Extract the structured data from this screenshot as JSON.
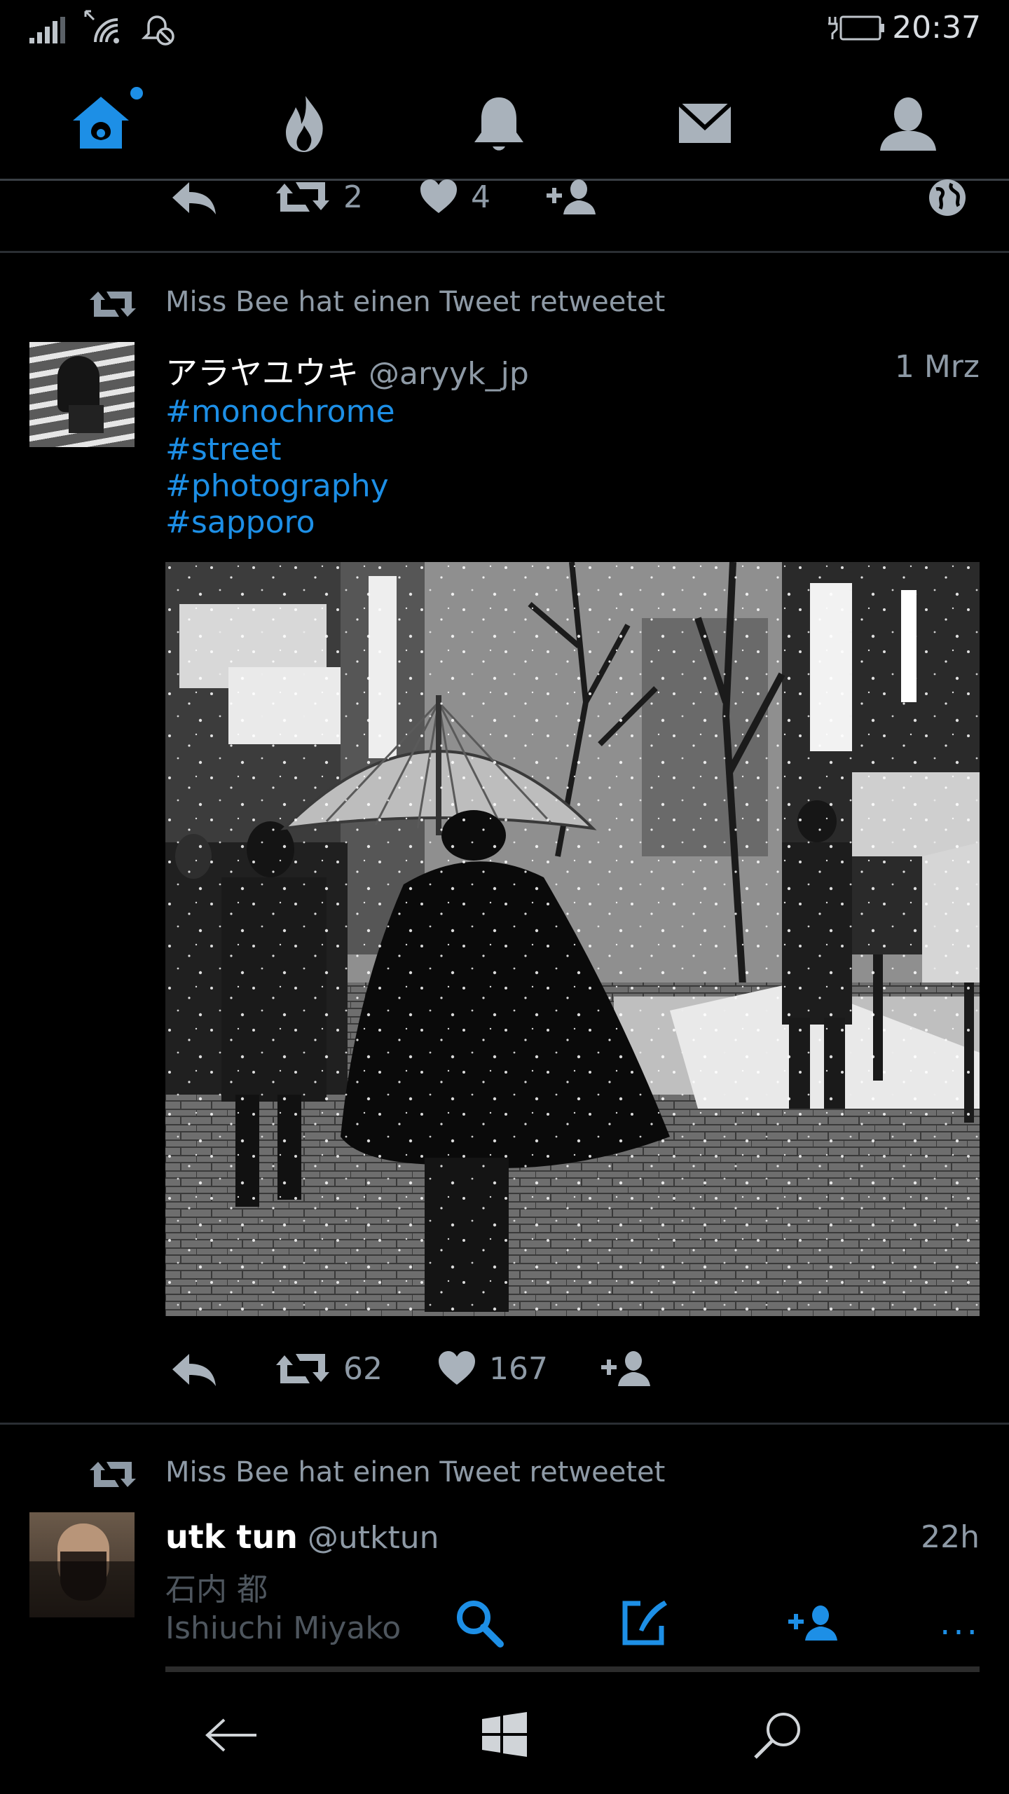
{
  "status": {
    "time": "20:37"
  },
  "nav": {
    "tabs": [
      {
        "name": "home",
        "icon": "home-icon",
        "active": true
      },
      {
        "name": "trending",
        "icon": "flame-icon"
      },
      {
        "name": "notifications",
        "icon": "bell-icon"
      },
      {
        "name": "messages",
        "icon": "mail-icon"
      },
      {
        "name": "profile",
        "icon": "person-icon"
      }
    ],
    "accent": "#1d8fe6"
  },
  "prev_tweet_actions": {
    "retweets": "2",
    "likes": "4"
  },
  "tweets": [
    {
      "retweeted_by": "Miss Bee hat einen Tweet retweetet",
      "name": "アラヤユウキ",
      "handle": "@aryyk_jp",
      "time": "1 Mrz",
      "hashtags": [
        "#monochrome",
        "#street",
        "#photography",
        "#sapporo"
      ],
      "retweets": "62",
      "likes": "167"
    },
    {
      "retweeted_by": "Miss Bee hat einen Tweet retweetet",
      "name": "utk tun",
      "handle": "@utktun",
      "time": "22h",
      "lines": [
        "石内 都",
        "Ishiuchi Miyako"
      ]
    }
  ],
  "app_bar": {
    "more": "..."
  }
}
